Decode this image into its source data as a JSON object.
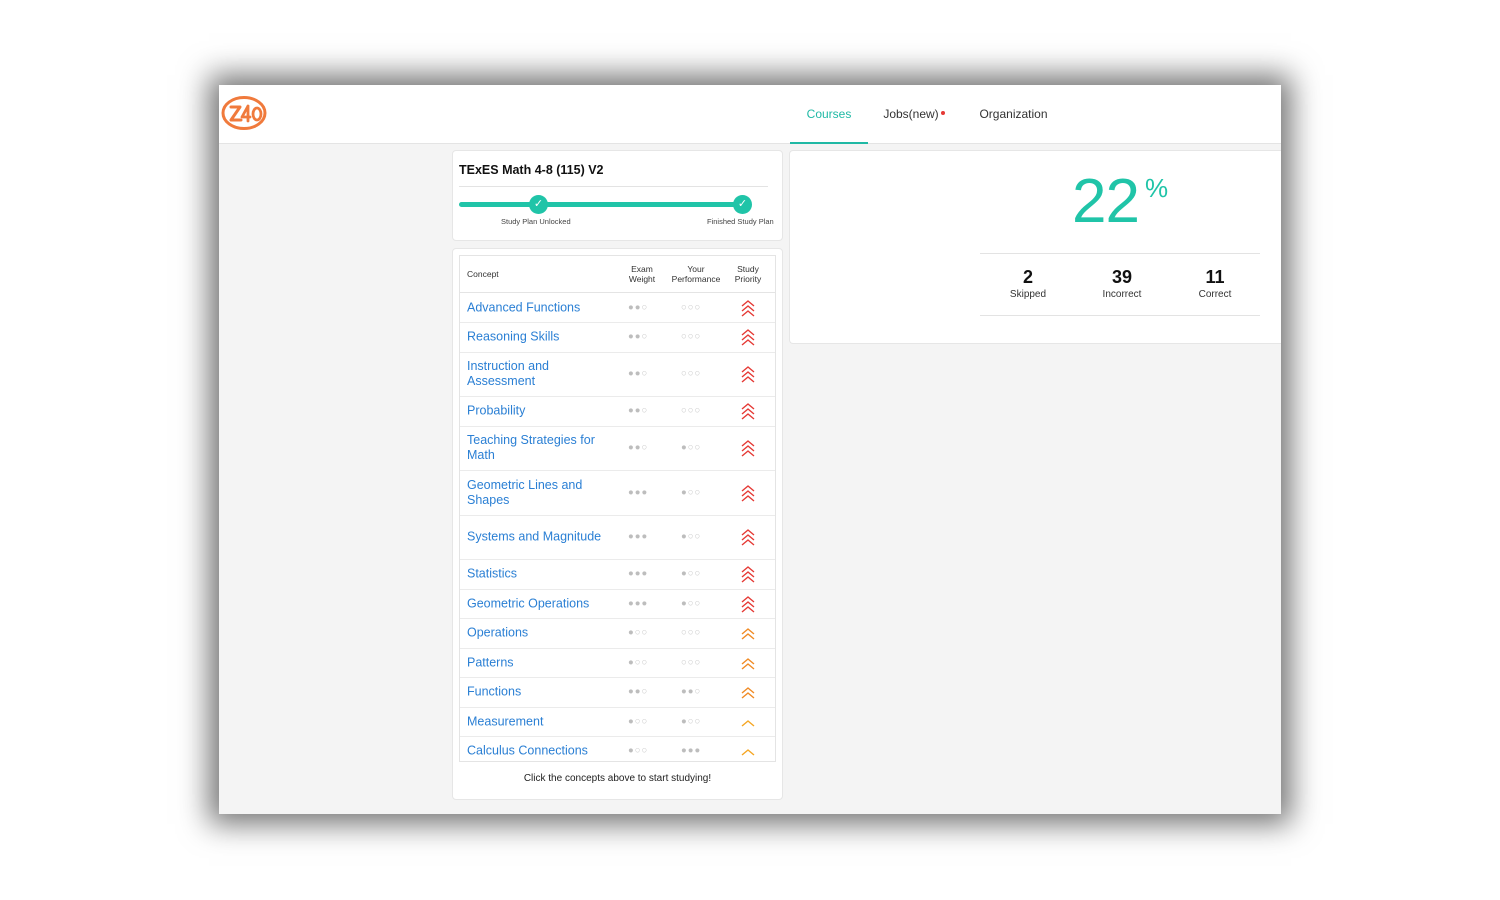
{
  "nav": {
    "items": [
      {
        "label": "Courses",
        "active": true
      },
      {
        "label": "Jobs(new)",
        "active": false,
        "badge": true
      },
      {
        "label": "Organization",
        "active": false
      }
    ]
  },
  "course": {
    "title": "TExES Math 4-8 (115) V2",
    "milestones": [
      {
        "label": "Study Plan Unlocked",
        "complete": true
      },
      {
        "label": "Finished Study Plan",
        "complete": true
      }
    ]
  },
  "table": {
    "headers": {
      "concept": "Concept",
      "exam_weight_1": "Exam",
      "exam_weight_2": "Weight",
      "performance_1": "Your",
      "performance_2": "Performance",
      "priority_1": "Study",
      "priority_2": "Priority"
    },
    "rows": [
      {
        "name": "Advanced Functions",
        "weight": 2,
        "performance": 0,
        "priority": "high"
      },
      {
        "name": "Reasoning Skills",
        "weight": 2,
        "performance": 0,
        "priority": "high"
      },
      {
        "name": "Instruction and Assessment",
        "weight": 2,
        "performance": 0,
        "priority": "high"
      },
      {
        "name": "Probability",
        "weight": 2,
        "performance": 0,
        "priority": "high"
      },
      {
        "name": "Teaching Strategies for Math",
        "weight": 2,
        "performance": 1,
        "priority": "high"
      },
      {
        "name": "Geometric Lines and Shapes",
        "weight": 3,
        "performance": 1,
        "priority": "high"
      },
      {
        "name": "Systems and Magnitude",
        "weight": 3,
        "performance": 1,
        "priority": "high"
      },
      {
        "name": "Statistics",
        "weight": 3,
        "performance": 1,
        "priority": "high"
      },
      {
        "name": "Geometric Operations",
        "weight": 3,
        "performance": 1,
        "priority": "high"
      },
      {
        "name": "Operations",
        "weight": 1,
        "performance": 0,
        "priority": "medium"
      },
      {
        "name": "Patterns",
        "weight": 1,
        "performance": 0,
        "priority": "medium"
      },
      {
        "name": "Functions",
        "weight": 2,
        "performance": 2,
        "priority": "medium"
      },
      {
        "name": "Measurement",
        "weight": 1,
        "performance": 1,
        "priority": "low"
      },
      {
        "name": "Calculus Connections",
        "weight": 1,
        "performance": 3,
        "priority": "low"
      }
    ],
    "hint": "Click the concepts above to start studying!"
  },
  "score": {
    "percent": "22",
    "percent_sign": "%",
    "stats": [
      {
        "value": "2",
        "label": "Skipped"
      },
      {
        "value": "39",
        "label": "Incorrect"
      },
      {
        "value": "11",
        "label": "Correct"
      }
    ]
  },
  "colors": {
    "accent": "#20c4a8",
    "link": "#2a7fd4",
    "priority_high": "#e53935",
    "priority_medium": "#f08a24",
    "priority_low": "#f5a623",
    "logo": "#f07a3c"
  }
}
